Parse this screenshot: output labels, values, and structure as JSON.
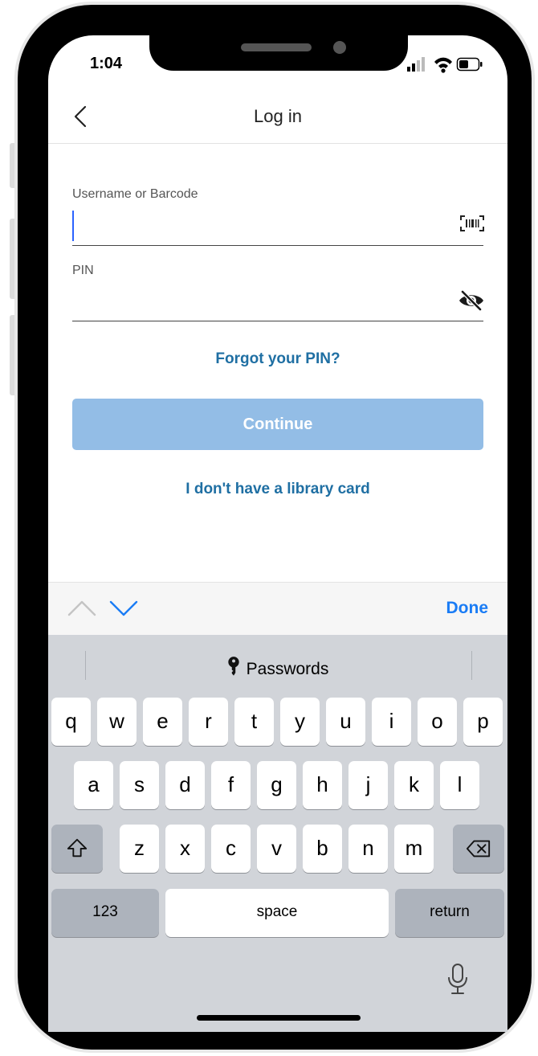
{
  "status_bar": {
    "time": "1:04"
  },
  "nav": {
    "title": "Log in",
    "back_icon": "chevron-left-icon"
  },
  "form": {
    "username_label": "Username or Barcode",
    "username_value": "",
    "barcode_icon": "barcode-scan-icon",
    "pin_label": "PIN",
    "pin_value": "",
    "visibility_icon": "eye-slash-icon"
  },
  "links": {
    "forgot_pin": "Forgot your PIN?",
    "no_card": "I don't have a library card"
  },
  "continue_button": {
    "label": "Continue",
    "enabled": false,
    "color": "#93bde6"
  },
  "keyboard_accessory": {
    "done_label": "Done",
    "prev_icon": "chevron-up-icon",
    "next_icon": "chevron-down-icon",
    "accent": "#1a7cf5"
  },
  "keyboard": {
    "passwords_label": "Passwords",
    "passwords_icon": "key-icon",
    "row1": [
      "q",
      "w",
      "e",
      "r",
      "t",
      "y",
      "u",
      "i",
      "o",
      "p"
    ],
    "row2": [
      "a",
      "s",
      "d",
      "f",
      "g",
      "h",
      "j",
      "k",
      "l"
    ],
    "row3": [
      "z",
      "x",
      "c",
      "v",
      "b",
      "n",
      "m"
    ],
    "shift_icon": "shift-icon",
    "delete_icon": "backspace-icon",
    "numbers_label": "123",
    "space_label": "space",
    "return_label": "return",
    "mic_icon": "microphone-icon"
  },
  "colors": {
    "link": "#1f6fa3",
    "caret": "#2b63ff"
  }
}
